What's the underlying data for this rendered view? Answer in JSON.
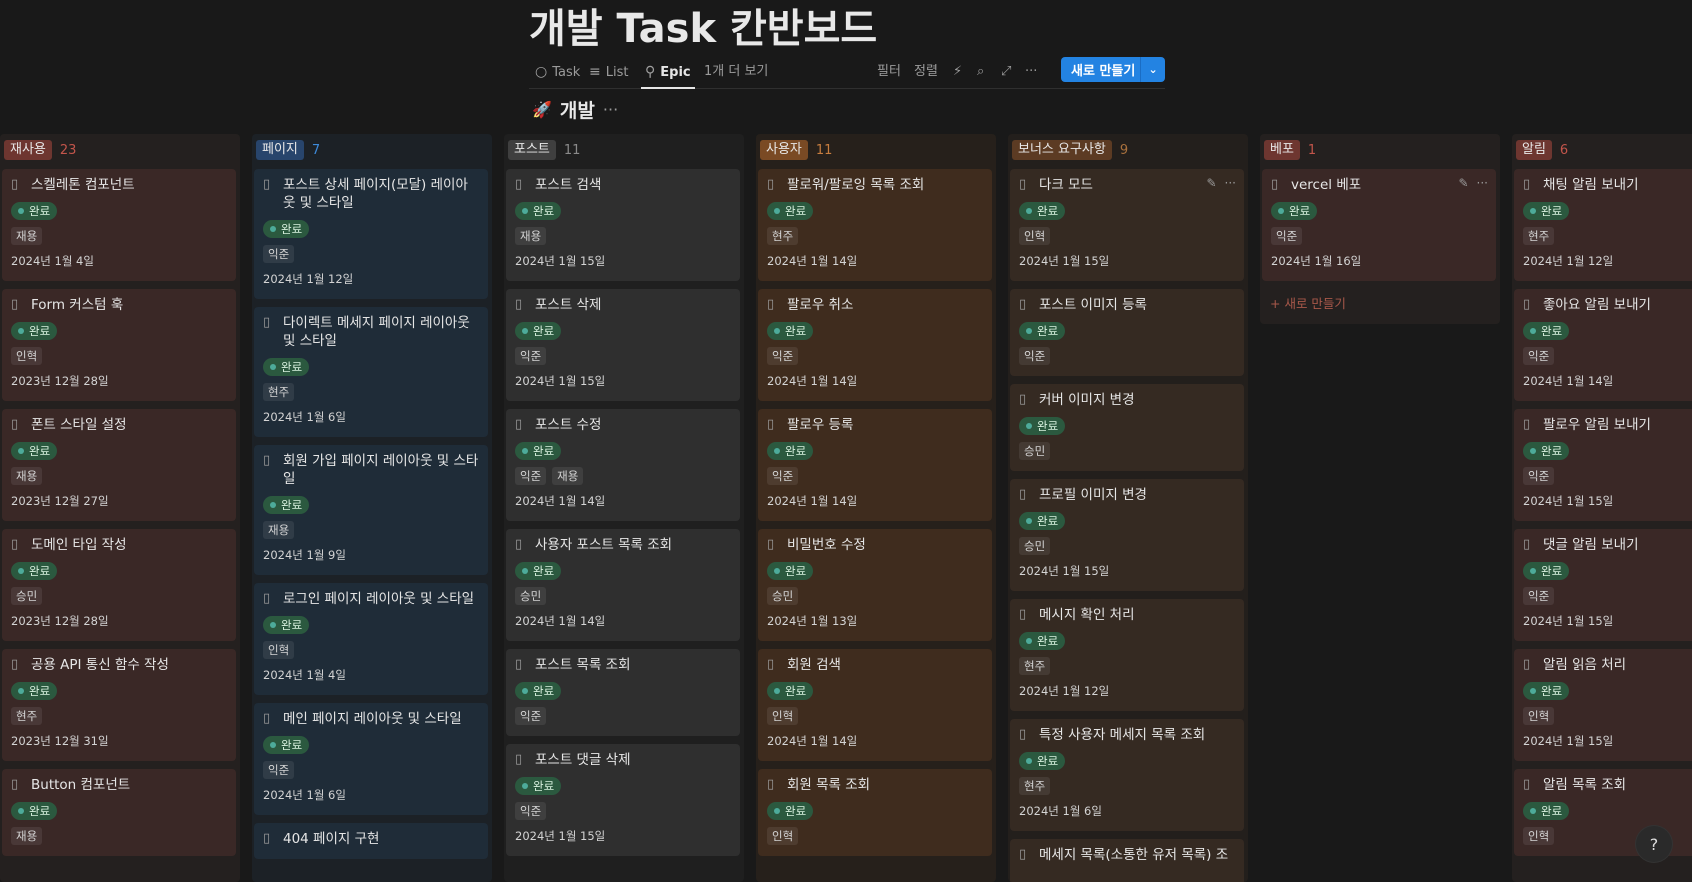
{
  "title": "개발 Task 칸반보드",
  "views": {
    "task": "Task",
    "list": "List",
    "epic": "Epic",
    "more": "1개 더 보기"
  },
  "toolbar": {
    "filter": "필터",
    "sort": "정렬",
    "new": "새로 만들기"
  },
  "group": {
    "emoji": "🚀",
    "name": "개발",
    "more": "···"
  },
  "columns": [
    {
      "name": "재사용",
      "count": "23",
      "tag_color": "#6e3630",
      "col_bg": "#24201f",
      "card_bg": "#3a2826",
      "count_color": "#c3554b",
      "cards": [
        {
          "title": "스켈레톤 컴포넌트",
          "status": "완료",
          "people": [
            "재용"
          ],
          "date": "2024년 1월 4일"
        },
        {
          "title": "Form 커스텀 훅",
          "status": "완료",
          "people": [
            "인혁"
          ],
          "date": "2023년 12월 28일"
        },
        {
          "title": "폰트 스타일 설정",
          "status": "완료",
          "people": [
            "재용"
          ],
          "date": "2023년 12월 27일"
        },
        {
          "title": "도메인 타입 작성",
          "status": "완료",
          "people": [
            "승민"
          ],
          "date": "2023년 12월 28일"
        },
        {
          "title": "공용 API 통신 함수 작성",
          "status": "완료",
          "people": [
            "현주"
          ],
          "date": "2023년 12월 31일"
        },
        {
          "title": "Button 컴포넌트",
          "status": "완료",
          "people": [
            "재용"
          ],
          "date": ""
        }
      ]
    },
    {
      "name": "페이지",
      "count": "7",
      "tag_color": "#28456c",
      "col_bg": "#1c2126",
      "card_bg": "#1f2c38",
      "count_color": "#3d8ad9",
      "cards": [
        {
          "title": "포스트 상세 페이지(모달) 레이아웃 및 스타일",
          "status": "완료",
          "people": [
            "익준"
          ],
          "date": "2024년 1월 12일"
        },
        {
          "title": "다이렉트 메세지 페이지 레이아웃 및 스타일",
          "status": "완료",
          "people": [
            "현주"
          ],
          "date": "2024년 1월 6일"
        },
        {
          "title": "회원 가입 페이지 레이아웃 및 스타일",
          "status": "완료",
          "people": [
            "재용"
          ],
          "date": "2024년 1월 9일"
        },
        {
          "title": "로그인 페이지 레이아웃 및 스타일",
          "status": "완료",
          "people": [
            "인혁"
          ],
          "date": "2024년 1월 4일"
        },
        {
          "title": "메인 페이지 레이아웃 및 스타일",
          "status": "완료",
          "people": [
            "익준"
          ],
          "date": "2024년 1월 6일"
        },
        {
          "title": "404 페이지 구현",
          "status": "",
          "people": [],
          "date": ""
        }
      ]
    },
    {
      "name": "포스트",
      "count": "11",
      "tag_color": "#3f3f3f",
      "col_bg": "#1f1f1f",
      "card_bg": "#2f2f2f",
      "count_color": "#8a8a8a",
      "cards": [
        {
          "title": "포스트 검색",
          "status": "완료",
          "people": [
            "재용"
          ],
          "date": "2024년 1월 15일"
        },
        {
          "title": "포스트 삭제",
          "status": "완료",
          "people": [
            "익준"
          ],
          "date": "2024년 1월 15일"
        },
        {
          "title": "포스트 수정",
          "status": "완료",
          "people": [
            "익준",
            "재용"
          ],
          "date": "2024년 1월 14일"
        },
        {
          "title": "사용자 포스트 목록 조회",
          "status": "완료",
          "people": [
            "승민"
          ],
          "date": "2024년 1월 14일"
        },
        {
          "title": "포스트 목록 조회",
          "status": "완료",
          "people": [
            "익준"
          ],
          "date": ""
        },
        {
          "title": "포스트 댓글 삭제",
          "status": "완료",
          "people": [
            "익준"
          ],
          "date": "2024년 1월 15일"
        }
      ]
    },
    {
      "name": "사용자",
      "count": "11",
      "tag_color": "#7a4a24",
      "col_bg": "#26201b",
      "card_bg": "#3f2c1e",
      "count_color": "#c77d3f",
      "cards": [
        {
          "title": "팔로워/팔로잉 목록 조회",
          "status": "완료",
          "people": [
            "현주"
          ],
          "date": "2024년 1월 14일"
        },
        {
          "title": "팔로우 취소",
          "status": "완료",
          "people": [
            "익준"
          ],
          "date": "2024년 1월 14일"
        },
        {
          "title": "팔로우 등록",
          "status": "완료",
          "people": [
            "익준"
          ],
          "date": "2024년 1월 14일"
        },
        {
          "title": "비밀번호 수정",
          "status": "완료",
          "people": [
            "승민"
          ],
          "date": "2024년 1월 13일"
        },
        {
          "title": "회원 검색",
          "status": "완료",
          "people": [
            "인혁"
          ],
          "date": "2024년 1월 14일"
        },
        {
          "title": "회원 목록 조회",
          "status": "완료",
          "people": [
            "인혁"
          ],
          "date": ""
        }
      ]
    },
    {
      "name": "보너스 요구사항",
      "count": "9",
      "tag_color": "#5c3b23",
      "col_bg": "#231f1c",
      "card_bg": "#352a22",
      "count_color": "#a9713d",
      "cards": [
        {
          "title": "다크 모드",
          "status": "완료",
          "people": [
            "인혁"
          ],
          "date": "2024년 1월 15일"
        },
        {
          "title": "포스트 이미지 등록",
          "status": "완료",
          "people": [
            "익준"
          ],
          "date": ""
        },
        {
          "title": "커버 이미지 변경",
          "status": "완료",
          "people": [
            "승민"
          ],
          "date": ""
        },
        {
          "title": "프로필 이미지 변경",
          "status": "완료",
          "people": [
            "승민"
          ],
          "date": "2024년 1월 15일"
        },
        {
          "title": "메시지 확인 처리",
          "status": "완료",
          "people": [
            "현주"
          ],
          "date": "2024년 1월 12일"
        },
        {
          "title": "특정 사용자 메세지 목록 조회",
          "status": "완료",
          "people": [
            "현주"
          ],
          "date": "2024년 1월 6일"
        },
        {
          "title": "메세지 목록(소통한 유저 목록) 조",
          "status": "",
          "people": [],
          "date": ""
        }
      ]
    },
    {
      "name": "베포",
      "count": "1",
      "tag_color": "#6e3630",
      "col_bg": "#24201f",
      "card_bg": "#3a2826",
      "count_color": "#c3554b",
      "cards": [
        {
          "title": "vercel 베포",
          "status": "완료",
          "people": [
            "익준"
          ],
          "date": "2024년 1월 16일"
        }
      ],
      "new_label": "새로 만들기"
    },
    {
      "name": "알림",
      "count": "6",
      "tag_color": "#6e3630",
      "col_bg": "#24201f",
      "card_bg": "#3a2826",
      "count_color": "#c3554b",
      "cards": [
        {
          "title": "채팅 알림 보내기",
          "status": "완료",
          "people": [
            "현주"
          ],
          "date": "2024년 1월 12일"
        },
        {
          "title": "좋아요 알림 보내기",
          "status": "완료",
          "people": [
            "익준"
          ],
          "date": "2024년 1월 14일"
        },
        {
          "title": "팔로우 알림 보내기",
          "status": "완료",
          "people": [
            "익준"
          ],
          "date": "2024년 1월 15일"
        },
        {
          "title": "댓글 알림 보내기",
          "status": "완료",
          "people": [
            "익준"
          ],
          "date": "2024년 1월 15일"
        },
        {
          "title": "알림 읽음 처리",
          "status": "완료",
          "people": [
            "인혁"
          ],
          "date": "2024년 1월 15일"
        },
        {
          "title": "알림 목록 조회",
          "status": "완료",
          "people": [
            "인혁"
          ],
          "date": ""
        }
      ]
    }
  ],
  "help": "?"
}
